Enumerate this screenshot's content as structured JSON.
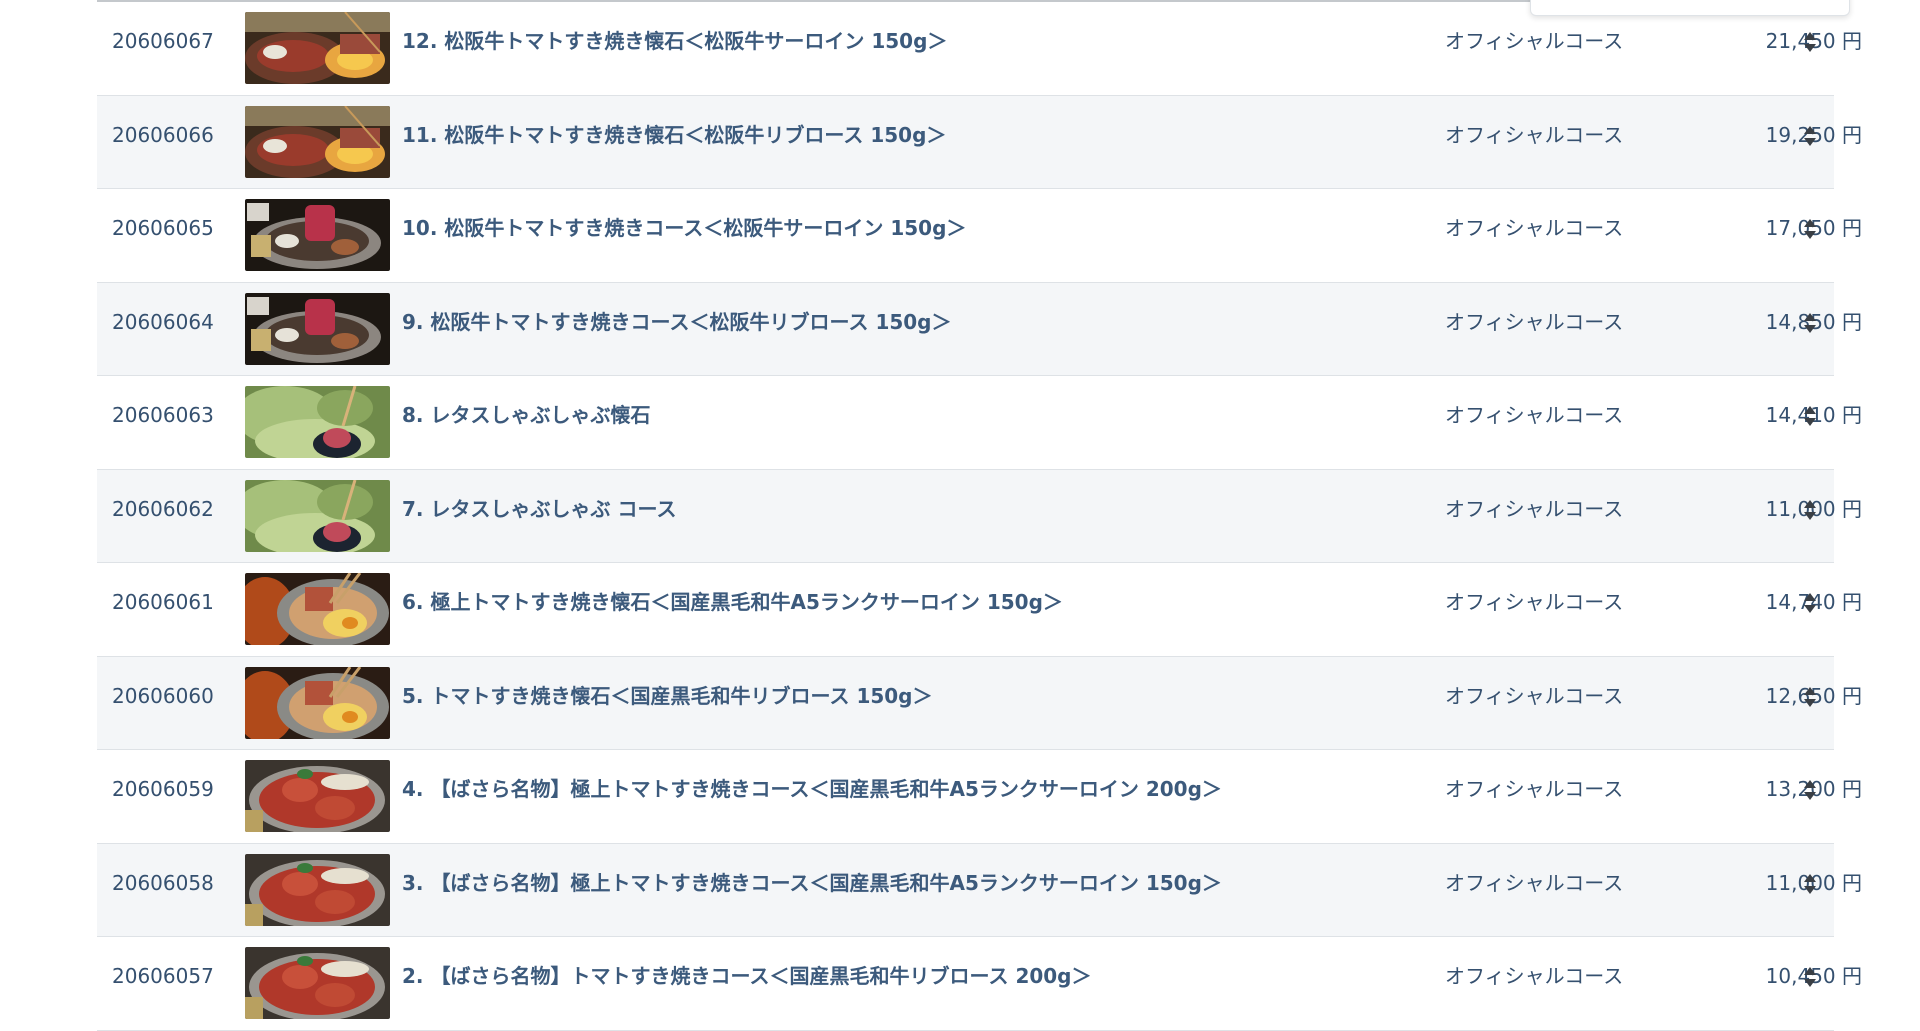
{
  "courses": [
    {
      "id": "20606067",
      "name": "12. 松阪牛トマトすき焼き懐石＜松阪牛サーロイン 150g＞",
      "category": "オフィシャルコース",
      "price": "21,450 円",
      "thumb": "sukiyaki-kaiseki"
    },
    {
      "id": "20606066",
      "name": "11.  松阪牛トマトすき焼き懐石＜松阪牛リブロース 150g＞",
      "category": "オフィシャルコース",
      "price": "19,250 円",
      "thumb": "sukiyaki-kaiseki"
    },
    {
      "id": "20606065",
      "name": "10. 松阪牛トマトすき焼きコース＜松阪牛サーロイン 150g＞",
      "category": "オフィシャルコース",
      "price": "17,050 円",
      "thumb": "sukiyaki-course"
    },
    {
      "id": "20606064",
      "name": "9. 松阪牛トマトすき焼きコース＜松阪牛リブロース 150g＞",
      "category": "オフィシャルコース",
      "price": "14,850 円",
      "thumb": "sukiyaki-course"
    },
    {
      "id": "20606063",
      "name": "8. レタスしゃぶしゃぶ懐石",
      "category": "オフィシャルコース",
      "price": "14,410 円",
      "thumb": "lettuce-shabu"
    },
    {
      "id": "20606062",
      "name": "7. レタスしゃぶしゃぶ コース",
      "category": "オフィシャルコース",
      "price": "11,000 円",
      "thumb": "lettuce-shabu"
    },
    {
      "id": "20606061",
      "name": "6. 極上トマトすき焼き懐石＜国産黒毛和牛A5ランクサーロイン 150g＞",
      "category": "オフィシャルコース",
      "price": "14,740 円",
      "thumb": "tomato-sukiyaki"
    },
    {
      "id": "20606060",
      "name": "5. トマトすき焼き懐石＜国産黒毛和牛リブロース 150g＞",
      "category": "オフィシャルコース",
      "price": "12,650 円",
      "thumb": "tomato-sukiyaki"
    },
    {
      "id": "20606059",
      "name": "4. 【ばさら名物】極上トマトすき焼きコース＜国産黒毛和牛A5ランクサーロイン 200g＞",
      "category": "オフィシャルコース",
      "price": "13,200 円",
      "thumb": "tomato-pot"
    },
    {
      "id": "20606058",
      "name": "3. 【ばさら名物】極上トマトすき焼きコース＜国産黒毛和牛A5ランクサーロイン 150g＞",
      "category": "オフィシャルコース",
      "price": "11,000 円",
      "thumb": "tomato-pot"
    },
    {
      "id": "20606057",
      "name": "2. 【ばさら名物】トマトすき焼きコース＜国産黒毛和牛リブロース 200g＞",
      "category": "オフィシャルコース",
      "price": "10,450 円",
      "thumb": "tomato-pot"
    }
  ],
  "colors": {
    "text": "#35506f",
    "name_text": "#3c5a7c",
    "row_alt": "#f4f6f8",
    "border": "#dee2e6"
  },
  "icons": {
    "sort": "sort-icon"
  }
}
